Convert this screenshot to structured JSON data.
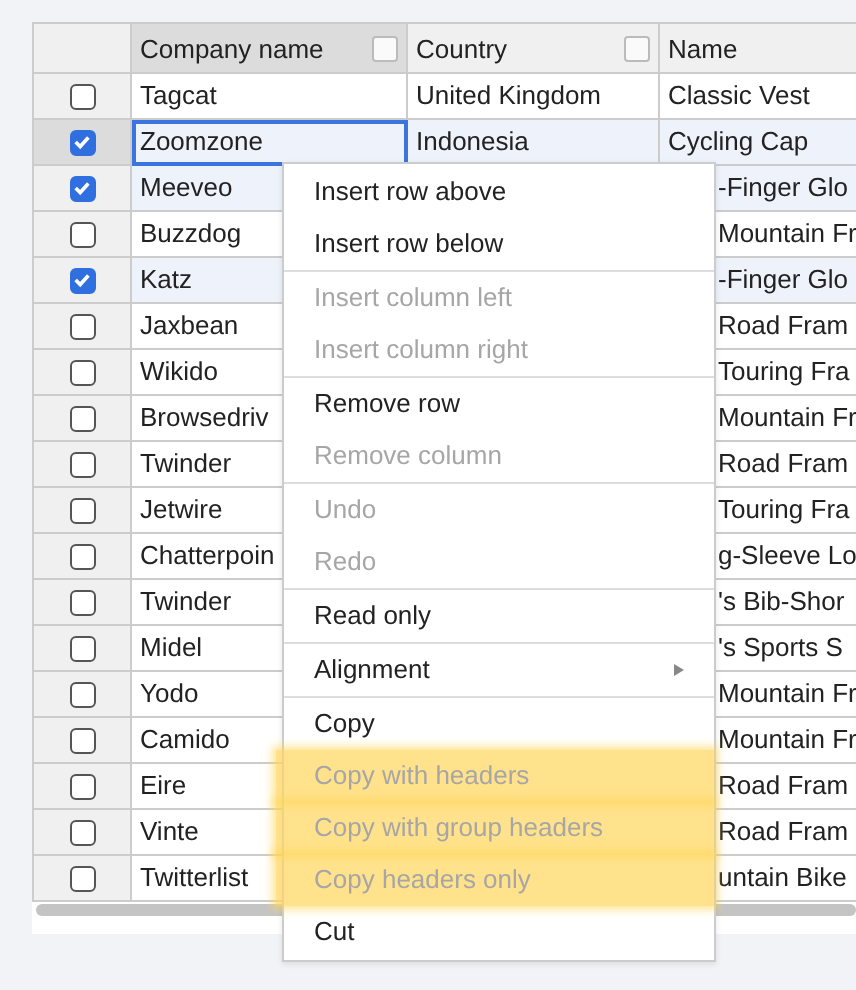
{
  "table": {
    "columns": [
      {
        "label": "Company name",
        "filter": true
      },
      {
        "label": "Country",
        "filter": true
      },
      {
        "label": "Name",
        "filter": false
      }
    ],
    "rows": [
      {
        "checked": false,
        "company": "Tagcat",
        "country": "United Kingdom",
        "name": "Classic Vest",
        "active": false
      },
      {
        "checked": true,
        "company": "Zoomzone",
        "country": "Indonesia",
        "name": "Cycling Cap",
        "active": true
      },
      {
        "checked": true,
        "company": "Meeveo",
        "name": "-Finger Glo",
        "active": false
      },
      {
        "checked": false,
        "company": "Buzzdog",
        "name": "Mountain Fr",
        "active": false
      },
      {
        "checked": true,
        "company": "Katz",
        "name": "-Finger Glo",
        "active": false
      },
      {
        "checked": false,
        "company": "Jaxbean",
        "name": "Road Fram",
        "active": false
      },
      {
        "checked": false,
        "company": "Wikido",
        "name": "Touring Fra",
        "active": false
      },
      {
        "checked": false,
        "company": "Browsedriv",
        "name": "Mountain Fr",
        "active": false
      },
      {
        "checked": false,
        "company": "Twinder",
        "name": "Road Fram",
        "active": false
      },
      {
        "checked": false,
        "company": "Jetwire",
        "name": "Touring Fra",
        "active": false
      },
      {
        "checked": false,
        "company": "Chatterpoin",
        "name": "g-Sleeve Lo",
        "active": false
      },
      {
        "checked": false,
        "company": "Twinder",
        "name": "'s Bib-Shor",
        "active": false
      },
      {
        "checked": false,
        "company": "Midel",
        "name": "'s Sports S",
        "active": false
      },
      {
        "checked": false,
        "company": "Yodo",
        "name": "Mountain Fr",
        "active": false
      },
      {
        "checked": false,
        "company": "Camido",
        "name": "Mountain Fr",
        "active": false
      },
      {
        "checked": false,
        "company": "Eire",
        "name": "Road Fram",
        "active": false
      },
      {
        "checked": false,
        "company": "Vinte",
        "name": "Road Fram",
        "active": false
      },
      {
        "checked": false,
        "company": "Twitterlist",
        "name": "untain Bike",
        "active": false
      }
    ]
  },
  "context_menu": [
    {
      "kind": "item",
      "label": "Insert row above",
      "disabled": false,
      "highlighted": false
    },
    {
      "kind": "item",
      "label": "Insert row below",
      "disabled": false,
      "highlighted": false
    },
    {
      "kind": "divider"
    },
    {
      "kind": "item",
      "label": "Insert column left",
      "disabled": true,
      "highlighted": false
    },
    {
      "kind": "item",
      "label": "Insert column right",
      "disabled": true,
      "highlighted": false
    },
    {
      "kind": "divider"
    },
    {
      "kind": "item",
      "label": "Remove row",
      "disabled": false,
      "highlighted": false
    },
    {
      "kind": "item",
      "label": "Remove column",
      "disabled": true,
      "highlighted": false
    },
    {
      "kind": "divider"
    },
    {
      "kind": "item",
      "label": "Undo",
      "disabled": true,
      "highlighted": false
    },
    {
      "kind": "item",
      "label": "Redo",
      "disabled": true,
      "highlighted": false
    },
    {
      "kind": "divider"
    },
    {
      "kind": "item",
      "label": "Read only",
      "disabled": false,
      "highlighted": false
    },
    {
      "kind": "divider"
    },
    {
      "kind": "item",
      "label": "Alignment",
      "disabled": false,
      "highlighted": false,
      "submenu": true
    },
    {
      "kind": "divider"
    },
    {
      "kind": "item",
      "label": "Copy",
      "disabled": false,
      "highlighted": false
    },
    {
      "kind": "item",
      "label": "Copy with headers",
      "disabled": true,
      "highlighted": true
    },
    {
      "kind": "item",
      "label": "Copy with group headers",
      "disabled": true,
      "highlighted": true
    },
    {
      "kind": "item",
      "label": "Copy headers only",
      "disabled": true,
      "highlighted": true
    },
    {
      "kind": "item",
      "label": "Cut",
      "disabled": false,
      "highlighted": false
    }
  ]
}
